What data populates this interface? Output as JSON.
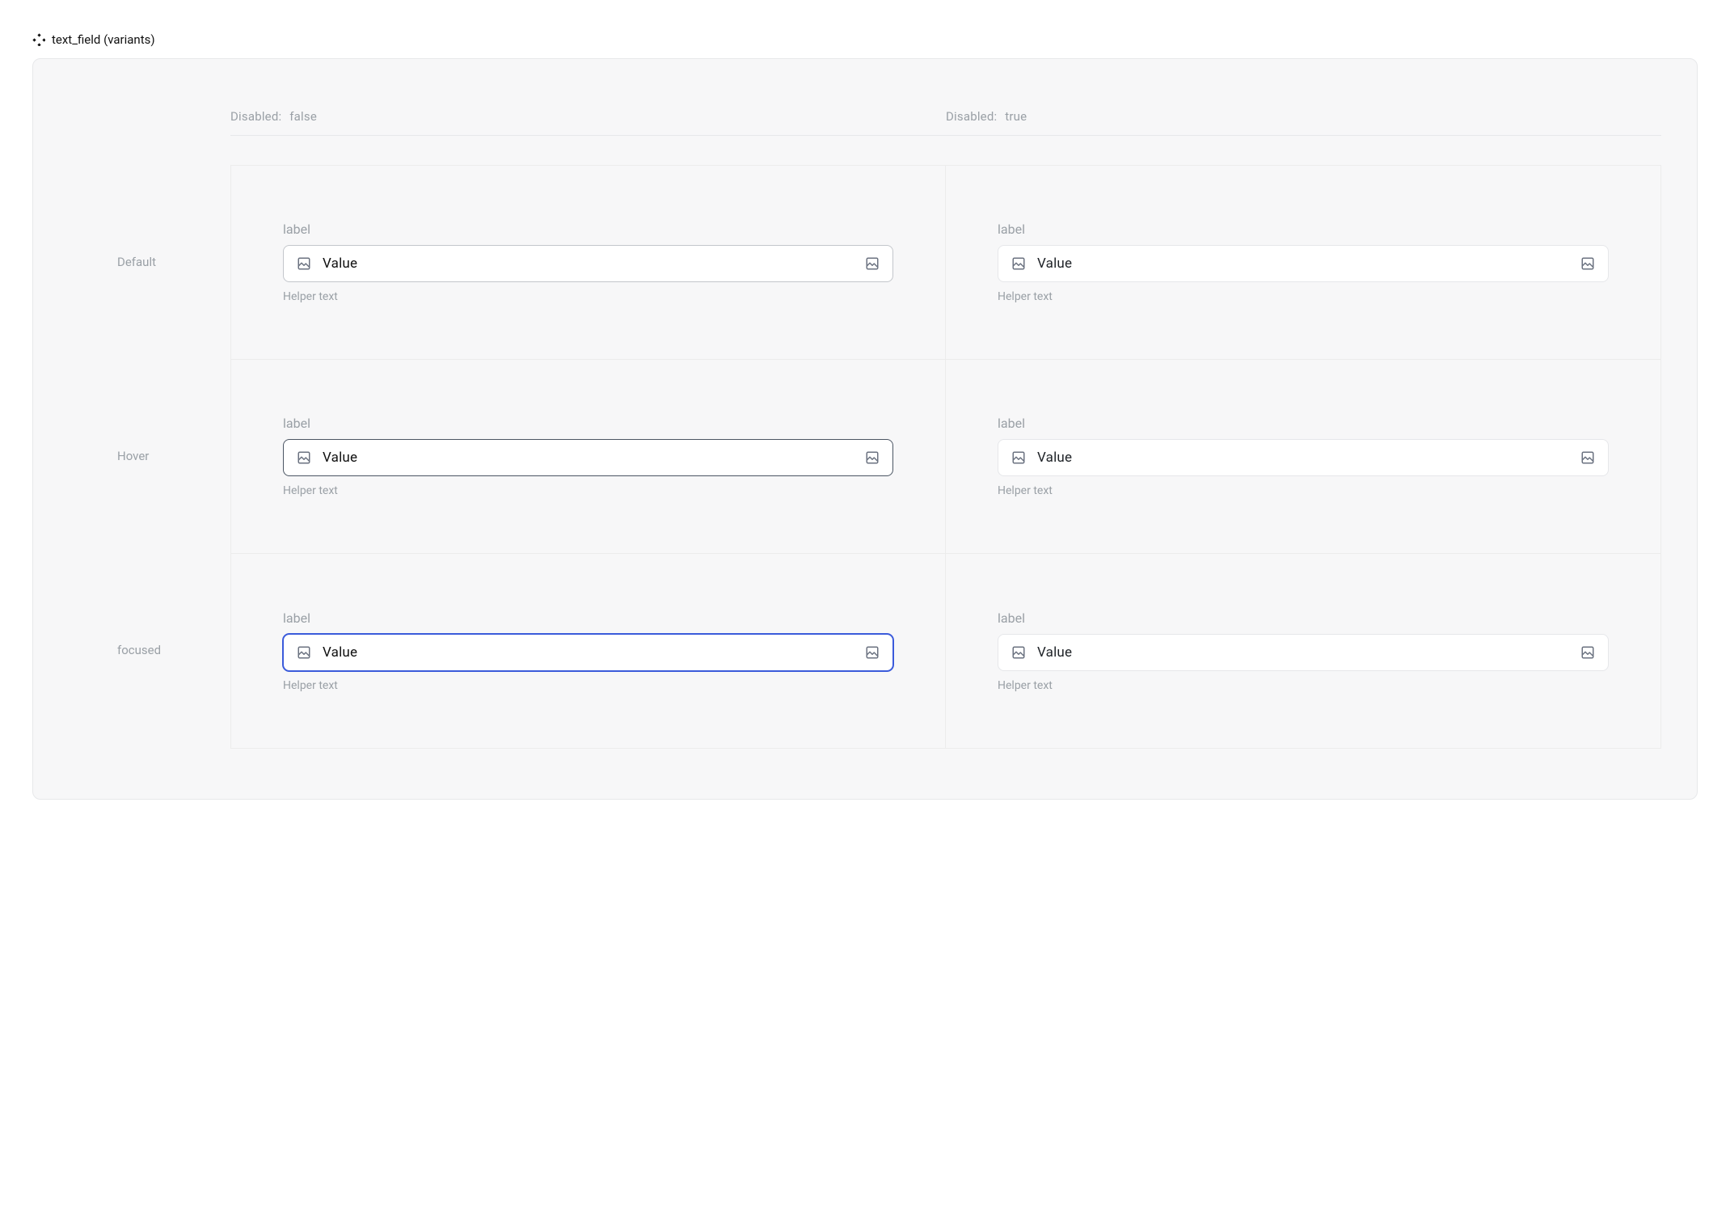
{
  "component": {
    "name": "text_field (variants)"
  },
  "columns": [
    {
      "property": "Disabled",
      "value": "false"
    },
    {
      "property": "Disabled",
      "value": "true"
    }
  ],
  "rows": [
    {
      "name": "Default"
    },
    {
      "name": "Hover"
    },
    {
      "name": "focused"
    }
  ],
  "cells": [
    {
      "row": "Default",
      "disabled": false,
      "label": "label",
      "value": "Value",
      "helper": "Helper text",
      "state": "default"
    },
    {
      "row": "Default",
      "disabled": true,
      "label": "label",
      "value": "Value",
      "helper": "Helper text",
      "state": "disabled"
    },
    {
      "row": "Hover",
      "disabled": false,
      "label": "label",
      "value": "Value",
      "helper": "Helper text",
      "state": "hover"
    },
    {
      "row": "Hover",
      "disabled": true,
      "label": "label",
      "value": "Value",
      "helper": "Helper text",
      "state": "disabled"
    },
    {
      "row": "focused",
      "disabled": false,
      "label": "label",
      "value": "Value",
      "helper": "Helper text",
      "state": "focused"
    },
    {
      "row": "focused",
      "disabled": true,
      "label": "label",
      "value": "Value",
      "helper": "Helper text",
      "state": "disabled"
    }
  ]
}
